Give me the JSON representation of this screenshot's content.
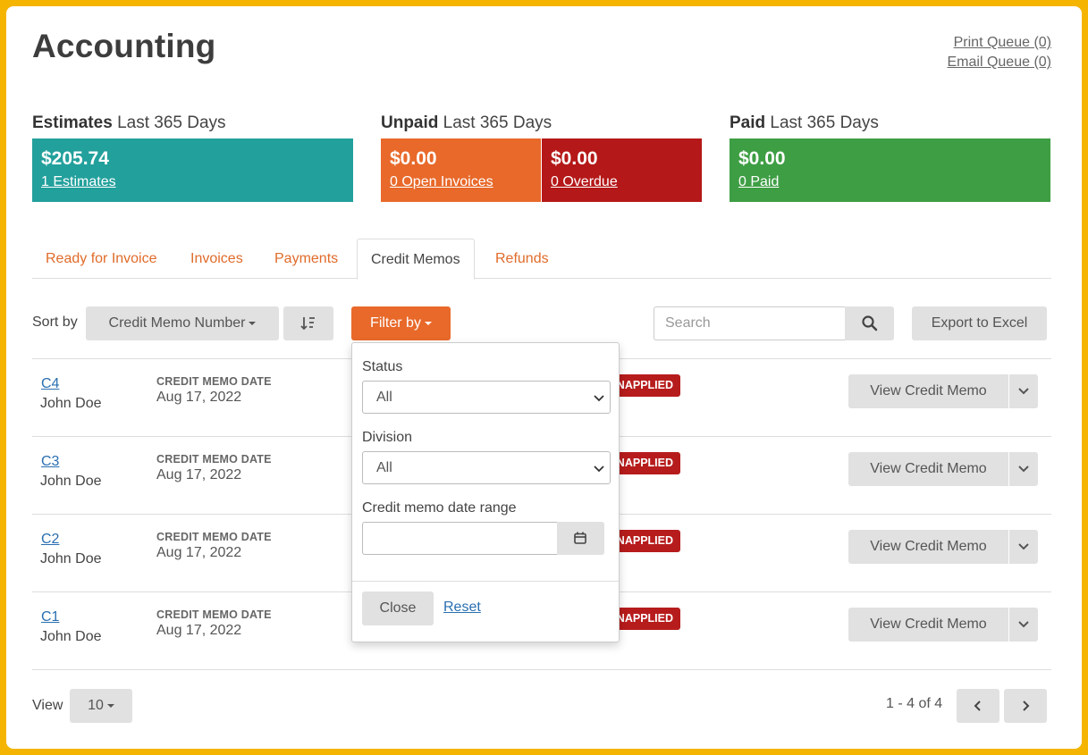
{
  "page": {
    "title": "Accounting"
  },
  "queue": {
    "print": "Print Queue (0)",
    "email": "Email Queue (0)"
  },
  "stats": {
    "estimates": {
      "label": "Estimates",
      "period": "Last 365 Days",
      "amount": "$205.74",
      "link": "1 Estimates",
      "color": "#22a09c"
    },
    "unpaid": {
      "label": "Unpaid",
      "period": "Last 365 Days",
      "open": {
        "amount": "$0.00",
        "link": "0 Open Invoices",
        "color": "#e8692a"
      },
      "overdue": {
        "amount": "$0.00",
        "link": "0 Overdue",
        "color": "#b51818"
      }
    },
    "paid": {
      "label": "Paid",
      "period": "Last 365 Days",
      "amount": "$0.00",
      "link": "0 Paid",
      "color": "#3e9e44"
    }
  },
  "tabs": [
    {
      "label": "Ready for Invoice",
      "active": false
    },
    {
      "label": "Invoices",
      "active": false
    },
    {
      "label": "Payments",
      "active": false
    },
    {
      "label": "Credit Memos",
      "active": true
    },
    {
      "label": "Refunds",
      "active": false
    }
  ],
  "toolbar": {
    "sort_label": "Sort by",
    "sort_value": "Credit Memo Number",
    "sort_direction_icon": "sort-descending-icon",
    "filter_label": "Filter by",
    "filter_color": "#e8692a",
    "search_placeholder": "Search",
    "export_label": "Export to Excel"
  },
  "filter": {
    "status_label": "Status",
    "status_value": "All",
    "division_label": "Division",
    "division_value": "All",
    "date_range_label": "Credit memo date range",
    "date_range_value": "",
    "close_label": "Close",
    "reset_label": "Reset"
  },
  "memos": [
    {
      "id": "C4",
      "customer": "John Doe",
      "date_label": "CREDIT MEMO DATE",
      "date": "Aug 17, 2022",
      "status": "UNAPPLIED",
      "status_visible": "NAPPLIED",
      "action": "View Credit Memo"
    },
    {
      "id": "C3",
      "customer": "John Doe",
      "date_label": "CREDIT MEMO DATE",
      "date": "Aug 17, 2022",
      "status": "UNAPPLIED",
      "status_visible": "NAPPLIED",
      "action": "View Credit Memo"
    },
    {
      "id": "C2",
      "customer": "John Doe",
      "date_label": "CREDIT MEMO DATE",
      "date": "Aug 17, 2022",
      "status": "UNAPPLIED",
      "status_visible": "NAPPLIED",
      "action": "View Credit Memo"
    },
    {
      "id": "C1",
      "customer": "John Doe",
      "date_label": "CREDIT MEMO DATE",
      "date": "Aug 17, 2022",
      "status": "UNAPPLIED",
      "status_visible": "NAPPLIED",
      "action": "View Credit Memo"
    }
  ],
  "pagination": {
    "view_label": "View",
    "page_size": "10",
    "range": "1 - 4 of 4"
  },
  "colors": {
    "frame": "#f4b400",
    "accent": "#e06b2a",
    "badge": "#b71c1c",
    "link": "#2a6fb0"
  }
}
